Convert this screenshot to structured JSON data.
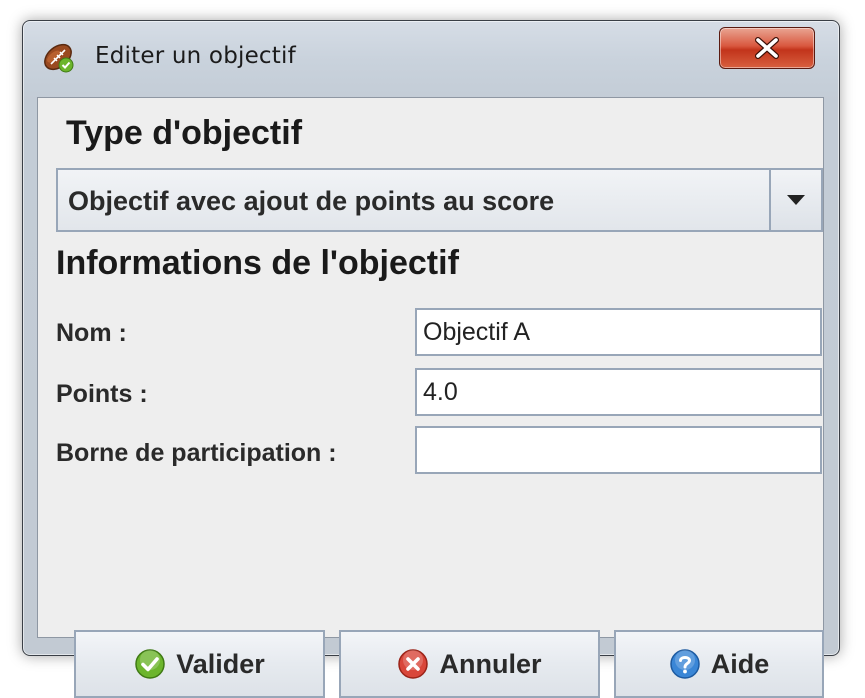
{
  "window": {
    "title": "Editer un objectif",
    "close_icon": "close-icon"
  },
  "type_section": {
    "heading": "Type d'objectif",
    "selected_type": "Objectif avec ajout de points au score"
  },
  "info_section": {
    "heading": "Informations de l'objectif",
    "fields": [
      {
        "label": "Nom :",
        "value": "Objectif A"
      },
      {
        "label": "Points :",
        "value": "4.0"
      },
      {
        "label": "Borne de participation :",
        "value": ""
      }
    ]
  },
  "buttons": {
    "validate": {
      "label": "Valider",
      "icon": "check-icon",
      "color": "#6cb52d"
    },
    "cancel": {
      "label": "Annuler",
      "icon": "x-circle-icon",
      "color": "#d9463a"
    },
    "help": {
      "label": "Aide",
      "icon": "question-icon",
      "color": "#3a86d6"
    }
  }
}
